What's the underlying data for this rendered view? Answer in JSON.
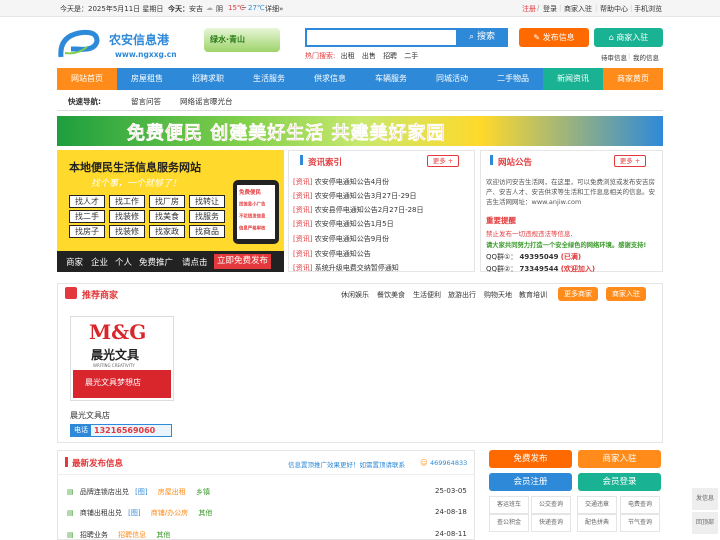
{
  "topbar": {
    "date": "今天是：2025年5月11日 星期日",
    "today": "今天：",
    "city": "安吉",
    "weather": "阴",
    "temp_low": "15℃",
    "temp_sep": "~",
    "temp_high": "27℃",
    "detail": "详细»",
    "register": "注册",
    "login": "登录",
    "merchant_entry": "商家入驻",
    "help": "帮助中心",
    "mobile": "手机浏览",
    "sep": "|",
    "slash": "/"
  },
  "logo": {
    "name": "农安信息港",
    "url": "www.ngxxg.cn",
    "slogan": "绿水·青山"
  },
  "search": {
    "placeholder": "",
    "button": "搜索",
    "hot_label": "热门搜索:",
    "hot": [
      "出租",
      "出售",
      "招聘",
      "二手"
    ]
  },
  "header_buttons": {
    "publish": "发布信息",
    "merchant": "商家入驻",
    "pending": "待审信息",
    "sep": "|",
    "pending_mine": "我的信息"
  },
  "nav": [
    "网站首页",
    "房屋租售",
    "招聘求职",
    "生活服务",
    "供求信息",
    "车辆服务",
    "同城活动",
    "二手物品",
    "新闻资讯",
    "商家黄页"
  ],
  "quick": {
    "label": "快速导航:",
    "links": [
      "留言问答",
      "网络谣言曝光台"
    ]
  },
  "banner": {
    "text": "免费便民 创建美好生活 共建美好家园"
  },
  "ad": {
    "title": "本地便民生活信息服务网站",
    "subtitle": "找个事，一个就够了！",
    "items": [
      "找人才",
      "找工作",
      "找厂房",
      "找转让",
      "找二手",
      "找装修",
      "找美食",
      "找服务",
      "找房子",
      "找装修",
      "找家政",
      "找商品"
    ],
    "phone_tags": [
      "免费便民",
      "找信息小广告",
      "不花钱发信息",
      "信息严格审核"
    ],
    "bottom": [
      "商家",
      "企业",
      "个人",
      "免费推广",
      "请点击"
    ],
    "cta": "立即免费发布"
  },
  "news": {
    "title": "资讯索引",
    "more": "更多 +",
    "tag": "[资讯]",
    "items": [
      "农安停电通知公告4月份",
      "农安停电通知公告3月27日-29日",
      "农安县停电通知公告2月27日-28日",
      "农安停电通知公告1月5日",
      "农安停电通知公告9月份",
      "农安停电通知公告",
      "系统升级电费交纳暂停通知"
    ]
  },
  "notice": {
    "title": "网站公告",
    "more": "更多 +",
    "body": "欢迎访问安吉生活网，在这里，可以免费浏览或发布安吉房产、安吉人才、安吉供求等生活和工作息息相关的信息。安吉生活网网址：www.anjiw.com",
    "warn_title": "重要提醒",
    "warn_line1": "禁止发布一切违规违法等信息,",
    "warn_line2": "请大家共同努力打造一个安全绿色的网络环境。感谢支持!",
    "qq1_label": "QQ群①：",
    "qq1": "49395049",
    "qq1_note": "(已满)",
    "qq2_label": "QQ群②：",
    "qq2": "73349544",
    "qq2_note": "(欢迎加入)"
  },
  "merchants": {
    "title": "推荐商家",
    "cats": [
      "休闲娱乐",
      "餐饮美食",
      "生活便利",
      "旅游出行",
      "购物天地",
      "教育培训"
    ],
    "more": "更多商家",
    "join": "商家入驻",
    "featured": {
      "logo_text": "M&G",
      "logo_sub": "晨光文具",
      "logo_tagline": "WRITING CREATIVITY",
      "banner": "晨光文具梦想店",
      "name": "晨光文具店",
      "phone_label": "电话",
      "phone": "13216569060"
    }
  },
  "latest": {
    "title": "最新发布信息",
    "promo": "信息置顶推广效果更好！如需置顶请联系",
    "qq": "469964833",
    "rows": [
      {
        "title": "品牌连锁店出兑",
        "tag": "[图]",
        "cat": "房屋出租",
        "area": "乡镇",
        "date": "25-03-05"
      },
      {
        "title": "商铺出租出兑",
        "tag": "[图]",
        "cat": "商铺/办公房",
        "area": "其他",
        "date": "24-08-18"
      },
      {
        "title": "招聘业务",
        "tag": "",
        "cat": "招聘信息",
        "area": "其他",
        "date": "24-08-11"
      }
    ]
  },
  "side": {
    "publish": "免费发布",
    "merchant": "商家入驻",
    "member_center": "会员注册",
    "member_login": "会员登录",
    "tools": [
      "客运班车",
      "公交查询",
      "交通违章",
      "电费查询",
      "查公积金",
      "快递查询",
      "配色拼典",
      "节气查询"
    ]
  },
  "float": {
    "publish": "发信息",
    "top": "回顶部"
  }
}
